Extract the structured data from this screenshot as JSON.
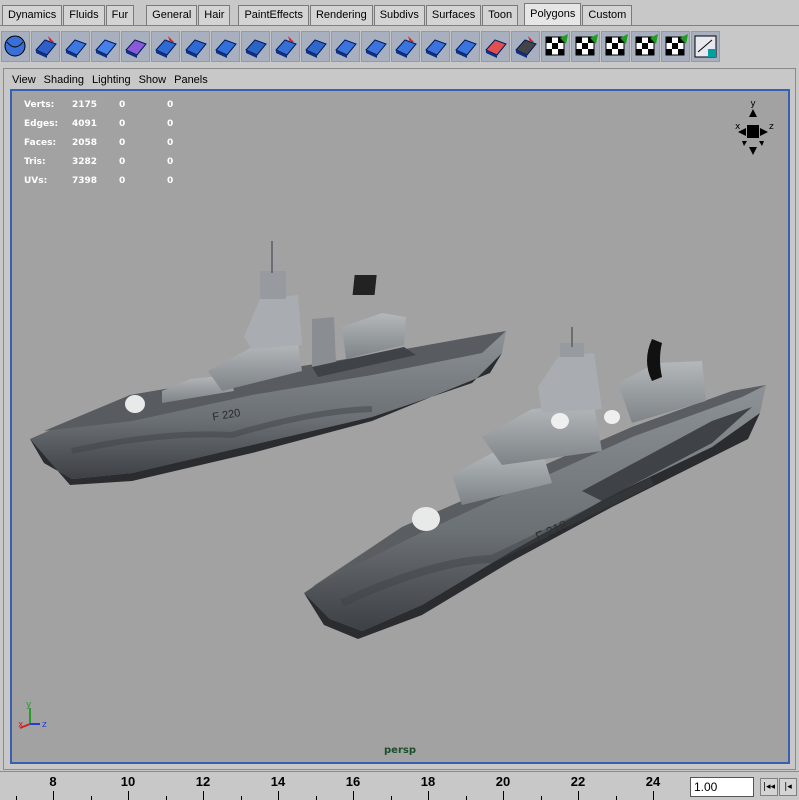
{
  "shelf": {
    "tabs": [
      {
        "label": "Dynamics"
      },
      {
        "label": "Fluids"
      },
      {
        "label": "Fur"
      },
      {
        "label": "General"
      },
      {
        "label": "Hair"
      },
      {
        "label": "PaintEffects"
      },
      {
        "label": "Rendering"
      },
      {
        "label": "Subdivs"
      },
      {
        "label": "Surfaces"
      },
      {
        "label": "Toon"
      },
      {
        "label": "Polygons",
        "active": true
      },
      {
        "label": "Custom"
      }
    ],
    "icons": [
      "polygon-sphere-icon",
      "polygon-cube-icon",
      "polygon-cylinder-icon",
      "polygon-plane-icon",
      "polygon-torus-icon",
      "create-polygon-tool-icon",
      "append-polygon-icon",
      "split-polygon-icon",
      "extrude-face-icon",
      "extrude-edge-icon",
      "bevel-icon",
      "wedge-faces-icon",
      "poke-faces-icon",
      "cut-faces-icon",
      "smooth-icon",
      "combine-icon",
      "separate-icon",
      "soft-edge-icon",
      "planar-mapping-icon",
      "cylindrical-mapping-icon",
      "spherical-mapping-icon",
      "automatic-mapping-icon",
      "uv-texture-editor-icon",
      "checker-uv-icon"
    ]
  },
  "panel": {
    "menus": [
      "View",
      "Shading",
      "Lighting",
      "Show",
      "Panels"
    ],
    "hud": [
      {
        "label": "Verts:",
        "values": [
          "2175",
          "0",
          "0"
        ]
      },
      {
        "label": "Edges:",
        "values": [
          "4091",
          "0",
          "0"
        ]
      },
      {
        "label": "Faces:",
        "values": [
          "2058",
          "0",
          "0"
        ]
      },
      {
        "label": "Tris:",
        "values": [
          "3282",
          "0",
          "0"
        ]
      },
      {
        "label": "UVs:",
        "values": [
          "7398",
          "0",
          "0"
        ]
      }
    ],
    "view_cube_axes": {
      "y": "y",
      "x": "x",
      "z": "z"
    },
    "axis_gizmo": {
      "x": "x",
      "y": "y",
      "z": "z"
    },
    "camera": "persp",
    "hull_labels": {
      "ship1": "F 220",
      "ship2": "F 218"
    },
    "border_color": "#3a5fb0",
    "background_color": "#a2a2a2"
  },
  "timeline": {
    "ticks": [
      "8",
      "10",
      "12",
      "14",
      "16",
      "18",
      "20",
      "22",
      "24"
    ],
    "current_frame": "1.00",
    "buttons": [
      "go-to-start-icon",
      "step-back-icon"
    ]
  }
}
